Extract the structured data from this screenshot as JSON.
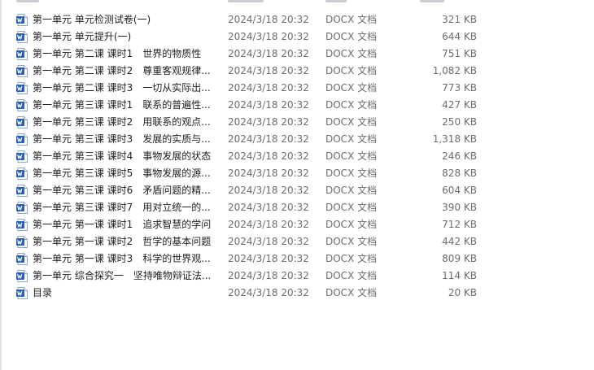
{
  "files": [
    {
      "name": "第一单元 单元检测试卷(一)",
      "date": "2024/3/18 20:32",
      "type": "DOCX 文档",
      "size": "321 KB",
      "icon": "word-doc-icon"
    },
    {
      "name": "第一单元 单元提升(一)",
      "date": "2024/3/18 20:32",
      "type": "DOCX 文档",
      "size": "644 KB",
      "icon": "word-doc-icon"
    },
    {
      "name": "第一单元 第二课 课时1　世界的物质性",
      "date": "2024/3/18 20:32",
      "type": "DOCX 文档",
      "size": "751 KB",
      "icon": "word-doc-icon"
    },
    {
      "name": "第一单元 第二课 课时2　尊重客观规律...",
      "date": "2024/3/18 20:32",
      "type": "DOCX 文档",
      "size": "1,082 KB",
      "icon": "word-doc-icon"
    },
    {
      "name": "第一单元 第二课 课时3　一切从实际出...",
      "date": "2024/3/18 20:32",
      "type": "DOCX 文档",
      "size": "773 KB",
      "icon": "word-doc-icon"
    },
    {
      "name": "第一单元 第三课 课时1　联系的普遍性...",
      "date": "2024/3/18 20:32",
      "type": "DOCX 文档",
      "size": "427 KB",
      "icon": "word-doc-icon"
    },
    {
      "name": "第一单元 第三课 课时2　用联系的观点...",
      "date": "2024/3/18 20:32",
      "type": "DOCX 文档",
      "size": "250 KB",
      "icon": "word-doc-icon"
    },
    {
      "name": "第一单元 第三课 课时3　发展的实质与...",
      "date": "2024/3/18 20:32",
      "type": "DOCX 文档",
      "size": "1,318 KB",
      "icon": "word-doc-icon"
    },
    {
      "name": "第一单元 第三课 课时4　事物发展的状态",
      "date": "2024/3/18 20:32",
      "type": "DOCX 文档",
      "size": "246 KB",
      "icon": "word-doc-icon"
    },
    {
      "name": "第一单元 第三课 课时5　事物发展的源...",
      "date": "2024/3/18 20:32",
      "type": "DOCX 文档",
      "size": "828 KB",
      "icon": "word-doc-icon"
    },
    {
      "name": "第一单元 第三课 课时6　矛盾问题的精...",
      "date": "2024/3/18 20:32",
      "type": "DOCX 文档",
      "size": "604 KB",
      "icon": "word-doc-icon"
    },
    {
      "name": "第一单元 第三课 课时7　用对立统一的...",
      "date": "2024/3/18 20:32",
      "type": "DOCX 文档",
      "size": "390 KB",
      "icon": "word-doc-icon"
    },
    {
      "name": "第一单元 第一课 课时1　追求智慧的学问",
      "date": "2024/3/18 20:32",
      "type": "DOCX 文档",
      "size": "712 KB",
      "icon": "word-doc-icon"
    },
    {
      "name": "第一单元 第一课 课时2　哲学的基本问题",
      "date": "2024/3/18 20:32",
      "type": "DOCX 文档",
      "size": "442 KB",
      "icon": "word-doc-icon"
    },
    {
      "name": "第一单元 第一课 课时3　科学的世界观...",
      "date": "2024/3/18 20:32",
      "type": "DOCX 文档",
      "size": "809 KB",
      "icon": "word-doc-icon"
    },
    {
      "name": "第一单元 综合探究一　坚持唯物辩证法...",
      "date": "2024/3/18 20:32",
      "type": "DOCX 文档",
      "size": "114 KB",
      "icon": "word-doc-icon"
    },
    {
      "name": "目录",
      "date": "2024/3/18 20:32",
      "type": "DOCX 文档",
      "size": "20 KB",
      "icon": "word-doc-icon"
    }
  ],
  "colors": {
    "word_blue": "#2b5fb4",
    "row_hover": "#e5f3ff",
    "meta_text": "#6d6d6d"
  }
}
